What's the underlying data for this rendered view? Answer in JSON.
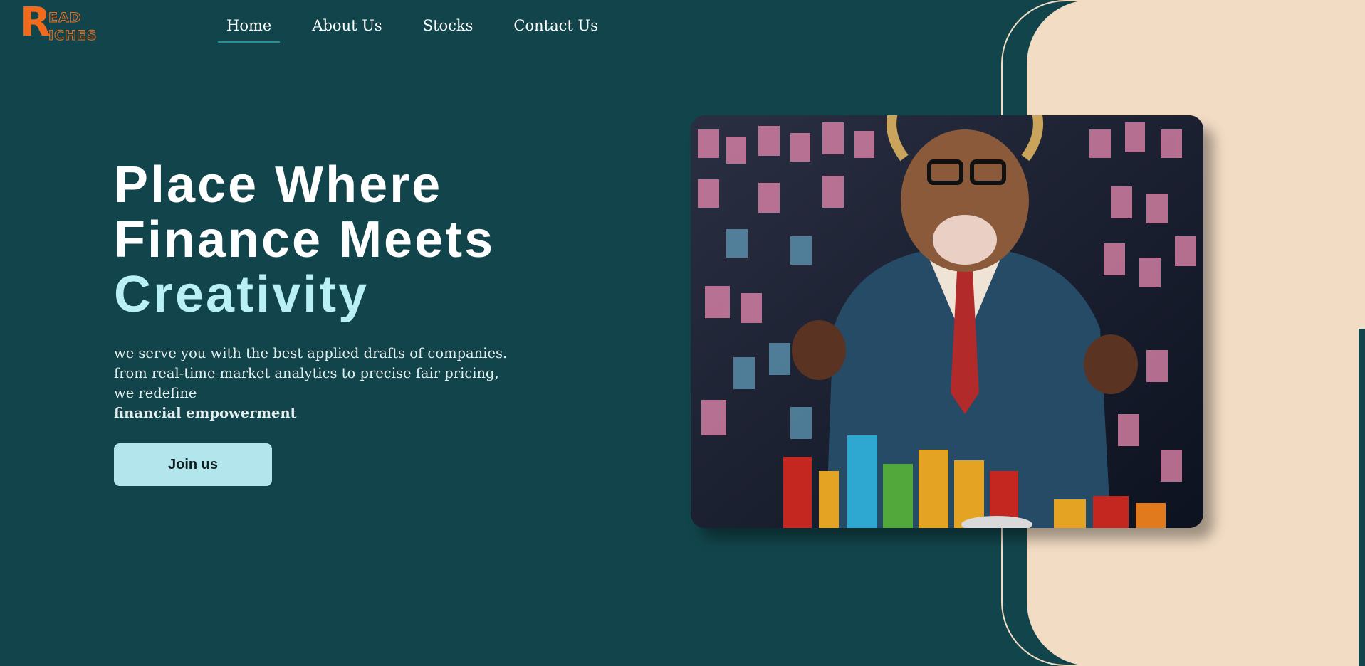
{
  "logo": {
    "initial": "R",
    "line1": "EAD",
    "line2": "ICHES"
  },
  "nav": {
    "items": [
      {
        "label": "Home",
        "active": true
      },
      {
        "label": "About Us",
        "active": false
      },
      {
        "label": "Stocks",
        "active": false
      },
      {
        "label": "Contact Us",
        "active": false
      }
    ]
  },
  "hero": {
    "title_line1": "Place Where",
    "title_line2": "Finance Meets",
    "title_line3": "Creativity",
    "desc_line1": "we serve you with the best applied drafts of companies.",
    "desc_line2": "from real-time market analytics to precise fair pricing,",
    "desc_line3": "we redefine",
    "desc_bold": "financial empowerment",
    "cta_label": "Join us"
  },
  "colors": {
    "background": "#12454b",
    "accent_panel": "#f2dcc4",
    "title_accent": "#b8f0f5",
    "button": "#b3e6ec",
    "logo": "#f26a1b"
  },
  "image": {
    "subject": "bull-in-suit-with-charts-illustration"
  }
}
